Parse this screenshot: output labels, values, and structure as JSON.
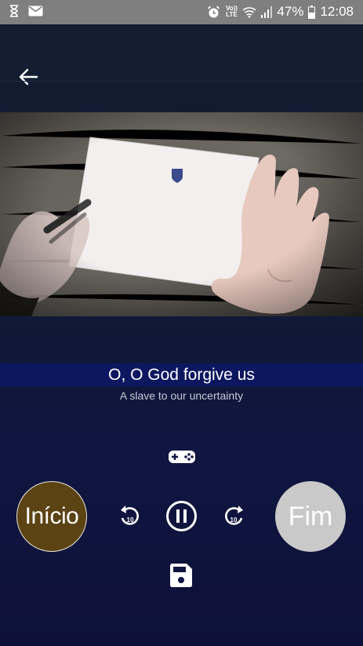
{
  "status_bar": {
    "battery": "47%",
    "time": "12:08",
    "network": "Vo)) LTE",
    "icons": [
      "hourglass-icon",
      "mail-icon",
      "alarm-icon",
      "wifi-icon",
      "signal-icon",
      "battery-icon"
    ]
  },
  "header": {
    "back_icon": "arrow-left-icon"
  },
  "video": {
    "description_icon": "video-frame"
  },
  "lyrics": {
    "current_line": "O, O God forgive us",
    "next_line": "A slave to our uncertainty"
  },
  "controls": {
    "start_label": "Início",
    "end_label": "Fim",
    "icons": [
      "gamepad-icon",
      "replay-10-icon",
      "pause-icon",
      "forward-10-icon",
      "save-icon"
    ]
  },
  "colors": {
    "status_bar": "#7f7f7f",
    "background": "#0f1640",
    "caption_highlight": "#0d1760",
    "start_button": "#5b4314",
    "end_button": "#c9c9c9"
  }
}
